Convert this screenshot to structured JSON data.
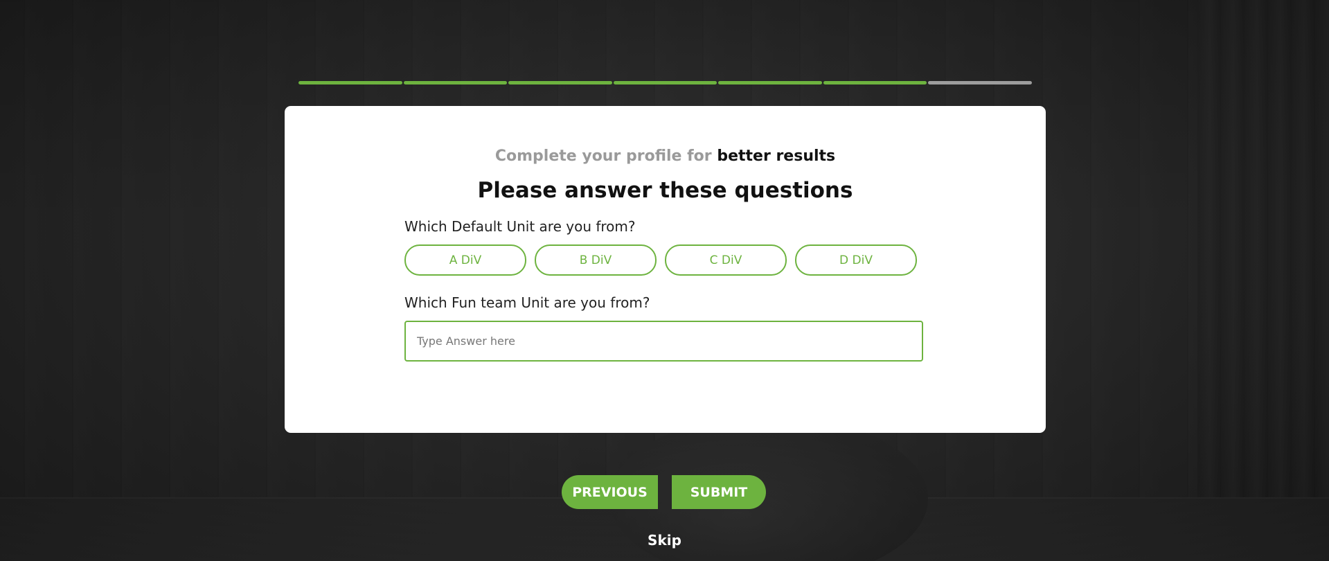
{
  "progress": {
    "total_steps": 7,
    "completed_steps": 6,
    "colors": {
      "completed": "#6db33f",
      "remaining": "#9d9d9d"
    }
  },
  "header": {
    "subtitle_muted": "Complete your profile for",
    "subtitle_strong": "better results",
    "title": "Please answer these questions"
  },
  "questions": {
    "q1": {
      "label": "Which Default Unit are you from?",
      "options": [
        "A DiV",
        "B DiV",
        "C DiV",
        "D DiV"
      ]
    },
    "q2": {
      "label": "Which Fun team Unit are you from?",
      "placeholder": "Type Answer here",
      "value": ""
    }
  },
  "actions": {
    "previous_label": "PREVIOUS",
    "submit_label": "SUBMIT",
    "skip_label": "Skip"
  },
  "colors": {
    "accent": "#6db33f",
    "card_bg": "#ffffff",
    "muted_text": "#9a9a9a"
  }
}
